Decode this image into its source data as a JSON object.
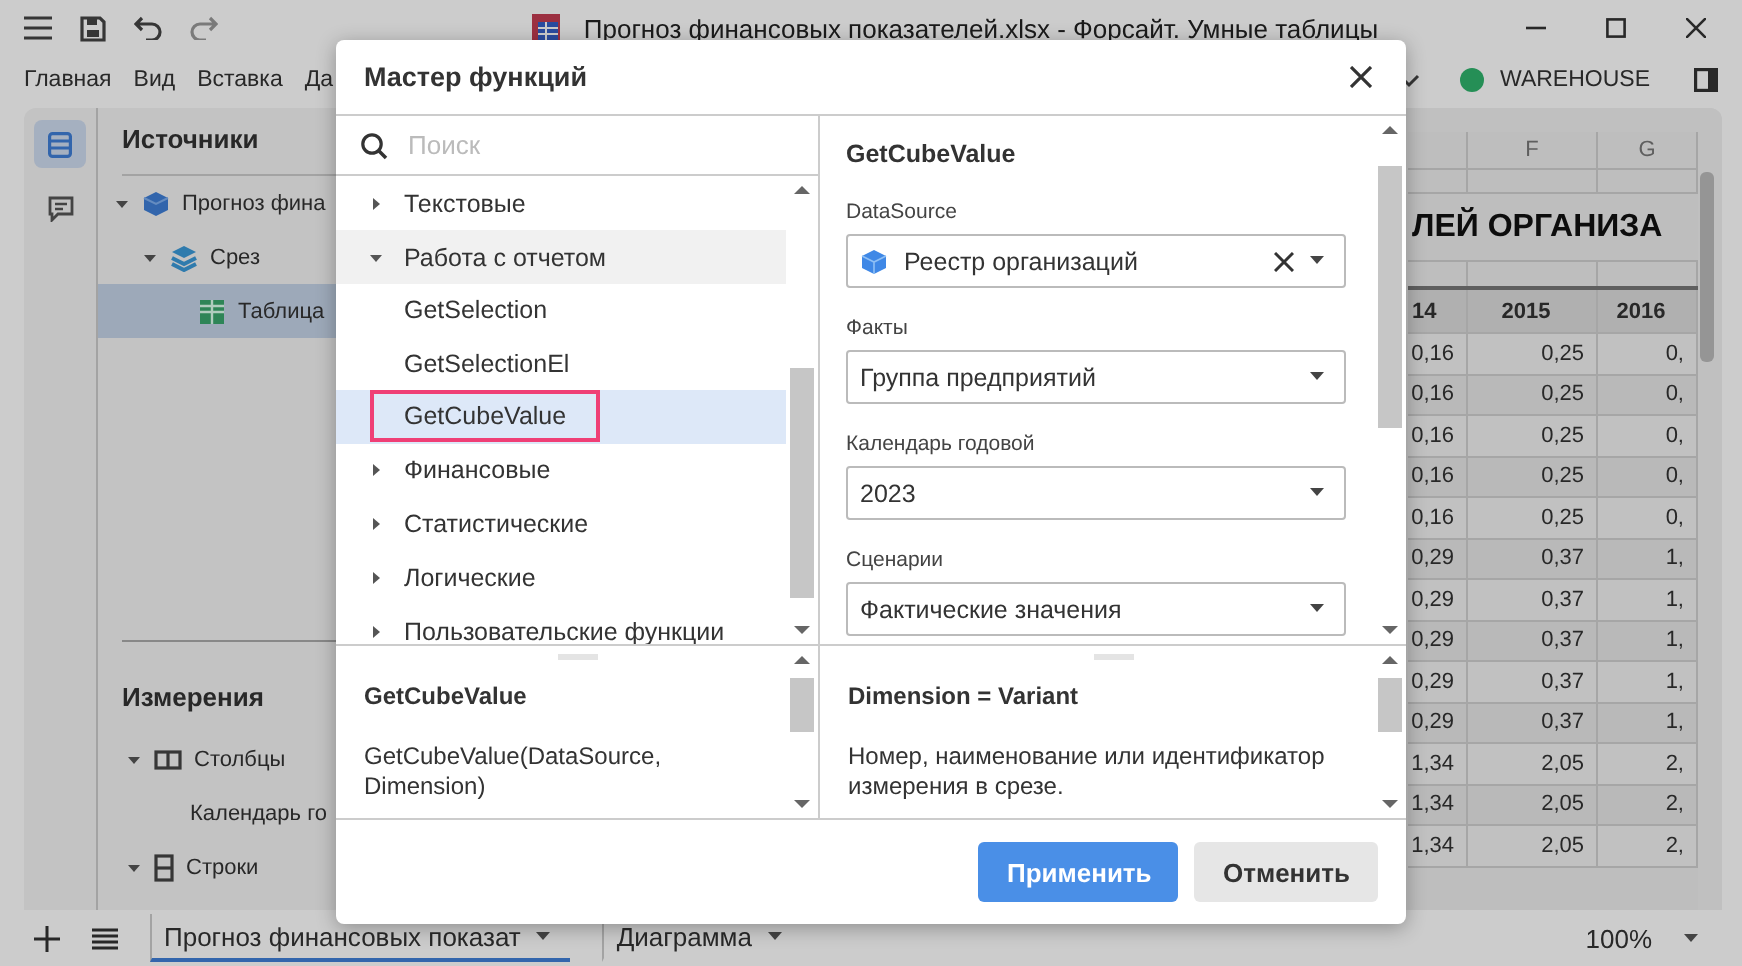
{
  "window": {
    "title": "Прогноз финансовых показателей.xlsx - Форсайт. Умные таблицы"
  },
  "menu": [
    "Главная",
    "Вид",
    "Вставка",
    "Да"
  ],
  "connection": {
    "name": "WAREHOUSE"
  },
  "sources": {
    "title": "Источники",
    "items": [
      {
        "label": "Прогноз фина",
        "kind": "cube",
        "expanded": true,
        "selected": false,
        "children": [
          {
            "label": "Срез",
            "kind": "slice",
            "expanded": true,
            "selected": false,
            "children": [
              {
                "label": "Таблица",
                "kind": "table",
                "selected": true
              }
            ]
          }
        ]
      }
    ]
  },
  "dimensions": {
    "title": "Измерения",
    "items": [
      {
        "label": "Столбцы",
        "kind": "columns",
        "expanded": true,
        "children": [
          {
            "label": "Календарь го"
          }
        ]
      },
      {
        "label": "Строки",
        "kind": "rows",
        "expanded": true
      }
    ]
  },
  "sheet": {
    "column_headers": [
      "F",
      "G"
    ],
    "title": "ЛЕЙ ОРГАНИЗА",
    "year_row": [
      "14",
      "2015",
      "2016"
    ],
    "rows": [
      [
        "0,16",
        "0,25",
        "0,"
      ],
      [
        "0,16",
        "0,25",
        "0,"
      ],
      [
        "0,16",
        "0,25",
        "0,"
      ],
      [
        "0,16",
        "0,25",
        "0,"
      ],
      [
        "0,16",
        "0,25",
        "0,"
      ],
      [
        "0,29",
        "0,37",
        "1,"
      ],
      [
        "0,29",
        "0,37",
        "1,"
      ],
      [
        "0,29",
        "0,37",
        "1,"
      ],
      [
        "0,29",
        "0,37",
        "1,"
      ],
      [
        "0,29",
        "0,37",
        "1,"
      ],
      [
        "1,34",
        "2,05",
        "2,"
      ],
      [
        "1,34",
        "2,05",
        "2,"
      ],
      [
        "1,34",
        "2,05",
        "2,"
      ]
    ]
  },
  "dialog": {
    "title": "Мастер функций",
    "search": {
      "placeholder": "Поиск"
    },
    "functions": [
      {
        "label": "Текстовые",
        "expanded": false
      },
      {
        "label": "Работа с отчетом",
        "expanded": true,
        "children": [
          {
            "label": "GetSelection",
            "selected": false
          },
          {
            "label": "GetSelectionEl",
            "selected": false
          },
          {
            "label": "GetCubeValue",
            "selected": true
          }
        ]
      },
      {
        "label": "Финансовые",
        "expanded": false
      },
      {
        "label": "Статистические",
        "expanded": false
      },
      {
        "label": "Логические",
        "expanded": false
      },
      {
        "label": "Пользовательские функции",
        "expanded": false
      }
    ],
    "function_name": "GetCubeValue",
    "params": [
      {
        "label": "DataSource",
        "value": "Реестр организаций",
        "kind": "source"
      },
      {
        "label": "Факты",
        "value": "Группа предприятий",
        "kind": "plain"
      },
      {
        "label": "Календарь годовой",
        "value": "2023",
        "kind": "plain"
      },
      {
        "label": "Сценарии",
        "value": "Фактические значения",
        "kind": "plain"
      }
    ],
    "syntax": {
      "title": "GetCubeValue",
      "text": "GetCubeValue(DataSource, Dimension)"
    },
    "param_help": {
      "title": "Dimension = Variant",
      "text": "Номер, наименование или идентификатор измерения в срезе."
    },
    "buttons": [
      {
        "label": "Применить",
        "kind": "primary"
      },
      {
        "label": "Отменить",
        "kind": "secondary"
      }
    ]
  },
  "sheet_tabs": [
    {
      "label": "Прогноз финансовых показат",
      "selected": true
    },
    {
      "label": "Диаграмма",
      "selected": false
    }
  ],
  "zoom": "100%"
}
